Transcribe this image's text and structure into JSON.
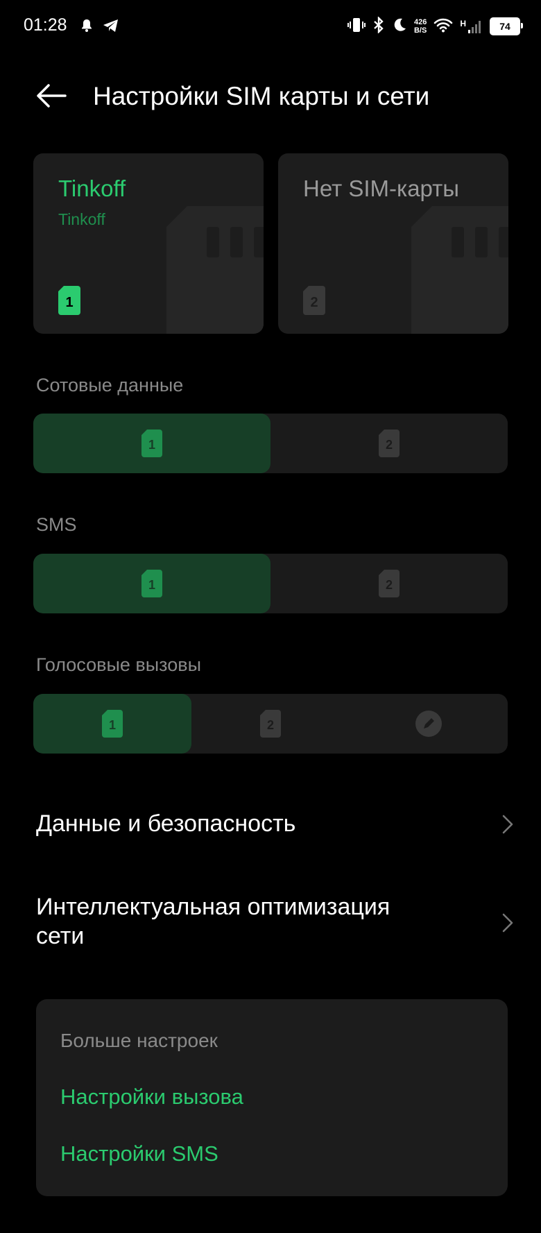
{
  "status_bar": {
    "time": "01:28",
    "net_speed_value": "426",
    "net_speed_unit": "B/S",
    "network_type": "H",
    "battery": "74"
  },
  "header": {
    "title": "Настройки SIM карты и сети"
  },
  "sim_cards": [
    {
      "name": "Tinkoff",
      "operator": "Tinkoff",
      "slot": "1",
      "active": true
    },
    {
      "name": "Нет SIM-карты",
      "operator": "",
      "slot": "2",
      "active": false
    }
  ],
  "sections": {
    "mobile_data": {
      "label": "Сотовые данные",
      "options": [
        "1",
        "2"
      ],
      "selected": "1"
    },
    "sms": {
      "label": "SMS",
      "options": [
        "1",
        "2"
      ],
      "selected": "1"
    },
    "calls": {
      "label": "Голосовые вызовы",
      "options": [
        "1",
        "2",
        "ask"
      ],
      "selected": "1"
    }
  },
  "rows": {
    "data_security": "Данные и безопасность",
    "smart_network_line1": "Интеллектуальная оптимизация",
    "smart_network_line2": "сети"
  },
  "more": {
    "title": "Больше настроек",
    "call_settings": "Настройки вызова",
    "sms_settings": "Настройки SMS"
  },
  "colors": {
    "accent": "#2bcb6f",
    "accent_dim": "#1f8f4e",
    "selected_segment": "#173f27",
    "card_bg": "#1d1d1d",
    "background": "#000000"
  },
  "icons": {
    "back": "arrow-left-icon",
    "chevron": "chevron-right-icon",
    "sim": "sim-card-icon",
    "ask": "pencil-circle-icon"
  }
}
